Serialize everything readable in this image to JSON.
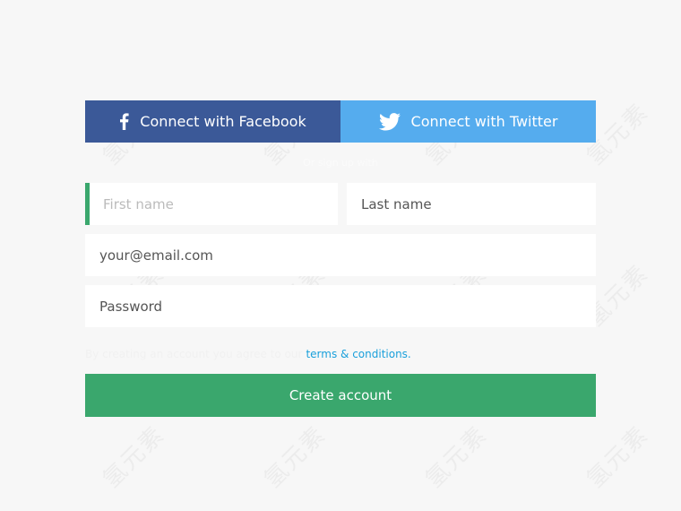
{
  "social": {
    "facebook_label": "Connect with Facebook",
    "twitter_label": "Connect with Twitter",
    "facebook_icon": "facebook-icon",
    "twitter_icon": "twitter-icon",
    "facebook_color": "#3b5998",
    "twitter_color": "#55acee"
  },
  "divider": {
    "text": "Or sign up with"
  },
  "form": {
    "first_name_placeholder": "First name",
    "last_name_placeholder": "Last name",
    "email_placeholder": "your@email.com",
    "password_placeholder": "Password"
  },
  "terms": {
    "prefix": "By creating an account you agree to our",
    "link_text": "terms & conditions."
  },
  "submit": {
    "label": "Create account",
    "color": "#3aa76d"
  },
  "watermark": {
    "text": "氢元素"
  }
}
